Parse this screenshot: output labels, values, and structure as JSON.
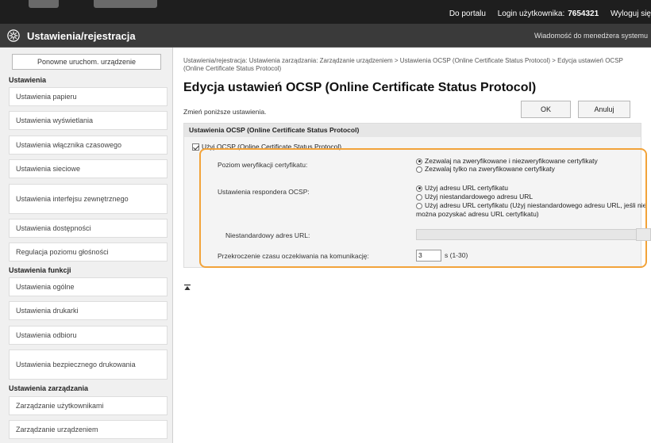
{
  "topbar": {
    "portal_link": "Do portalu",
    "user_label": "Login użytkownika:",
    "user_value": "7654321",
    "logout": "Wyloguj się"
  },
  "header": {
    "title": "Ustawienia/rejestracja",
    "admin_message": "Wiadomość do menedżera systemu",
    "icon": "gear-icon"
  },
  "sidebar": {
    "restart_button": "Ponowne uruchom. urządzenie",
    "section_settings": "Ustawienia",
    "settings_items": [
      "Ustawienia papieru",
      "Ustawienia wyświetlania",
      "Ustawienia włącznika czasowego",
      "Ustawienia sieciowe",
      "Ustawienia interfejsu zewnętrznego",
      "Ustawienia dostępności",
      "Regulacja poziomu głośności"
    ],
    "section_functions": "Ustawienia funkcji",
    "function_items": [
      "Ustawienia ogólne",
      "Ustawienia drukarki",
      "Ustawienia odbioru",
      "Ustawienia bezpiecznego drukowania"
    ],
    "section_management": "Ustawienia zarządzania",
    "management_items": [
      "Zarządzanie użytkownikami",
      "Zarządzanie urządzeniem"
    ]
  },
  "main": {
    "breadcrumb": "Ustawienia/rejestracja: Ustawienia zarządzania: Zarządzanie urządzeniem > Ustawienia OCSP (Online Certificate Status Protocol) > Edycja ustawień OCSP (Online Certificate Status Protocol)",
    "page_title": "Edycja ustawień OCSP (Online Certificate Status Protocol)",
    "note": "Zmień poniższe ustawienia.",
    "ok_button": "OK",
    "cancel_button": "Anuluj",
    "panel_header": "Ustawienia OCSP (Online Certificate Status Protocol)",
    "use_ocsp_label": "Użyj OCSP (Online Certificate Status Protocol)",
    "use_ocsp_checked": true,
    "verification_label": "Poziom weryfikacji certyfikatu:",
    "verification_options": [
      "Zezwalaj na zweryfikowane i niezweryfikowane certyfikaty",
      "Zezwalaj tylko na zweryfikowane certyfikaty"
    ],
    "verification_selected": 0,
    "responder_label": "Ustawienia respondera OCSP:",
    "responder_options": [
      "Użyj adresu URL certyfikatu",
      "Użyj niestandardowego adresu URL",
      "Użyj adresu URL certyfikatu (Użyj niestandardowego adresu URL, jeśli nie można pozyskać adresu URL certyfikatu)"
    ],
    "responder_option_3_line1": "Użyj adresu URL certyfikatu (Użyj niestandardowego adresu URL, jeśli nie",
    "responder_option_3_line2": "można pozyskać adresu URL certyfikatu)",
    "responder_selected": 0,
    "custom_url_label": "Niestandardowy adres URL:",
    "custom_url_value": "",
    "timeout_label": "Przekroczenie czasu oczekiwania na komunikację:",
    "timeout_value": "3",
    "timeout_unit": "s (1-30)",
    "to_top_icon": "to-top-icon",
    "highlight_color": "#f2a33a"
  }
}
